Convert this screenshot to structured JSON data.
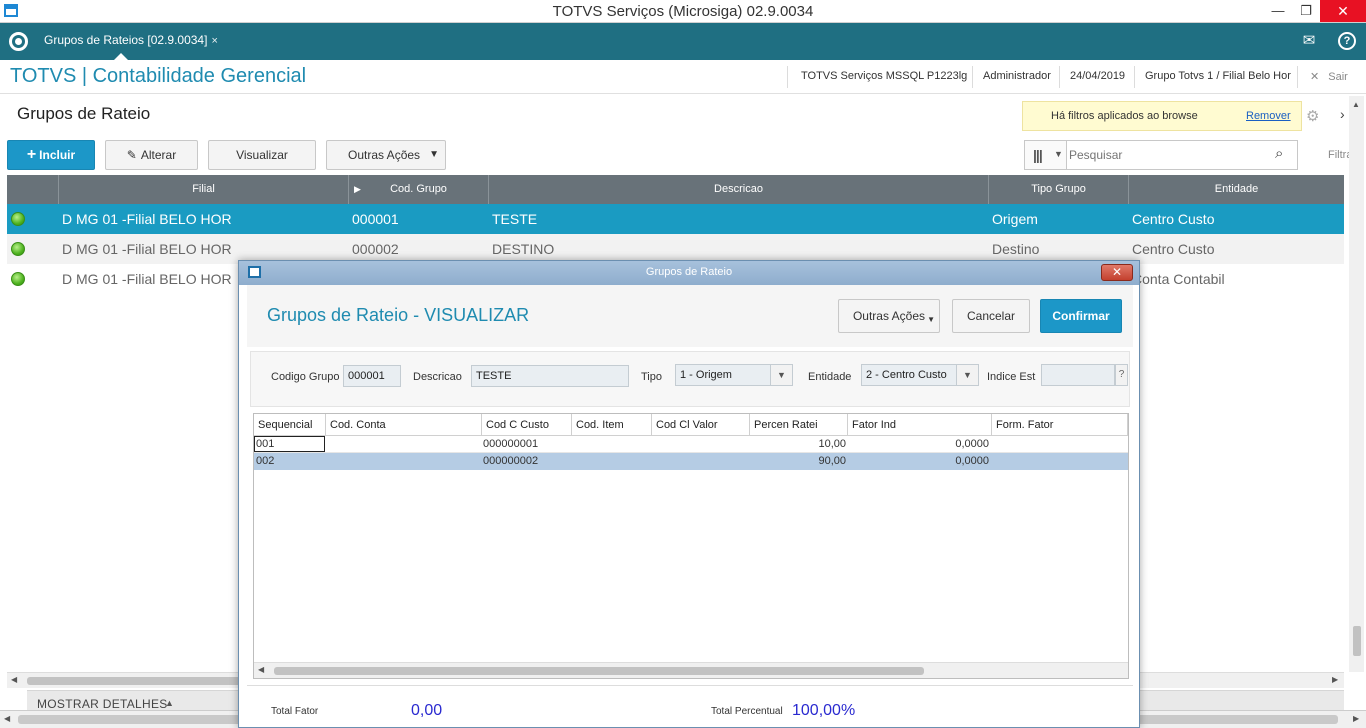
{
  "window": {
    "title": "TOTVS Serviços (Microsiga) 02.9.0034",
    "minimize": "—",
    "restore": "❐",
    "close": "✕"
  },
  "tabbar": {
    "tab_label": "Grupos de Rateios [02.9.0034]",
    "tab_close": "×",
    "mail_icon": "✉",
    "help_icon": "?"
  },
  "module": {
    "title": "TOTVS | Contabilidade Gerencial",
    "server": "TOTVS Serviços MSSQL P1223lg",
    "user": "Administrador",
    "date": "24/04/2019",
    "branch": "Grupo Totvs 1 / Filial Belo Hor",
    "exit_icon": "✕",
    "exit_label": "Sair"
  },
  "page": {
    "title": "Grupos de Rateio",
    "buttons": {
      "incluir": "Incluir",
      "alterar": "Alterar",
      "visualizar": "Visualizar",
      "outras": "Outras Ações"
    },
    "filter": {
      "text": "Há filtros aplicados ao browse",
      "remove": "Remover"
    },
    "search": {
      "placeholder": "Pesquisar",
      "filter_label": "Filtra"
    }
  },
  "grid": {
    "headers": [
      "Filial",
      "Cod. Grupo",
      "Descricao",
      "Tipo Grupo",
      "Entidade"
    ],
    "rows": [
      {
        "filial": "D MG 01 -Filial BELO HOR",
        "cod": "000001",
        "desc": "TESTE",
        "tipo": "Origem",
        "entidade": "Centro Custo"
      },
      {
        "filial": "D MG 01 -Filial BELO HOR",
        "cod": "000002",
        "desc": "DESTINO",
        "tipo": "Destino",
        "entidade": "Centro Custo"
      },
      {
        "filial": "D MG 01 -Filial BELO HOR",
        "cod": "",
        "desc": "",
        "tipo": "",
        "entidade": "Conta Contabil"
      }
    ]
  },
  "details": {
    "label": "MOSTRAR DETALHES"
  },
  "modal": {
    "window_title": "Grupos de Rateio",
    "title": "Grupos de Rateio - VISUALIZAR",
    "buttons": {
      "outras": "Outras Ações",
      "cancelar": "Cancelar",
      "confirmar": "Confirmar"
    },
    "fields": {
      "codigo_label": "Codigo Grupo",
      "codigo": "000001",
      "descricao_label": "Descricao",
      "descricao": "TESTE",
      "tipo_label": "Tipo",
      "tipo": "1 - Origem",
      "entidade_label": "Entidade",
      "entidade": "2 - Centro Custo",
      "indice_label": "Indice Est",
      "indice": ""
    },
    "items_headers": [
      "Sequencial",
      "Cod. Conta",
      "Cod C Custo",
      "Cod. Item",
      "Cod Cl Valor",
      "Percen Ratei",
      "Fator Ind",
      "Form. Fator"
    ],
    "items": [
      {
        "seq": "001",
        "conta": "",
        "ccusto": "000000001",
        "item": "",
        "clvalor": "",
        "percen": "10,00",
        "fator": "0,0000",
        "form": ""
      },
      {
        "seq": "002",
        "conta": "",
        "ccusto": "000000002",
        "item": "",
        "clvalor": "",
        "percen": "90,00",
        "fator": "0,0000",
        "form": ""
      }
    ],
    "footer": {
      "total_fator_label": "Total Fator",
      "total_fator": "0,00",
      "total_percentual_label": "Total Percentual",
      "total_percentual": "100,00%"
    }
  },
  "colors": {
    "accent": "#1c97c8",
    "tabbar": "#1f6f82",
    "grid_header": "#687279",
    "selected_row": "#1a9bc2",
    "modal_selected_row": "#b5cce4"
  }
}
